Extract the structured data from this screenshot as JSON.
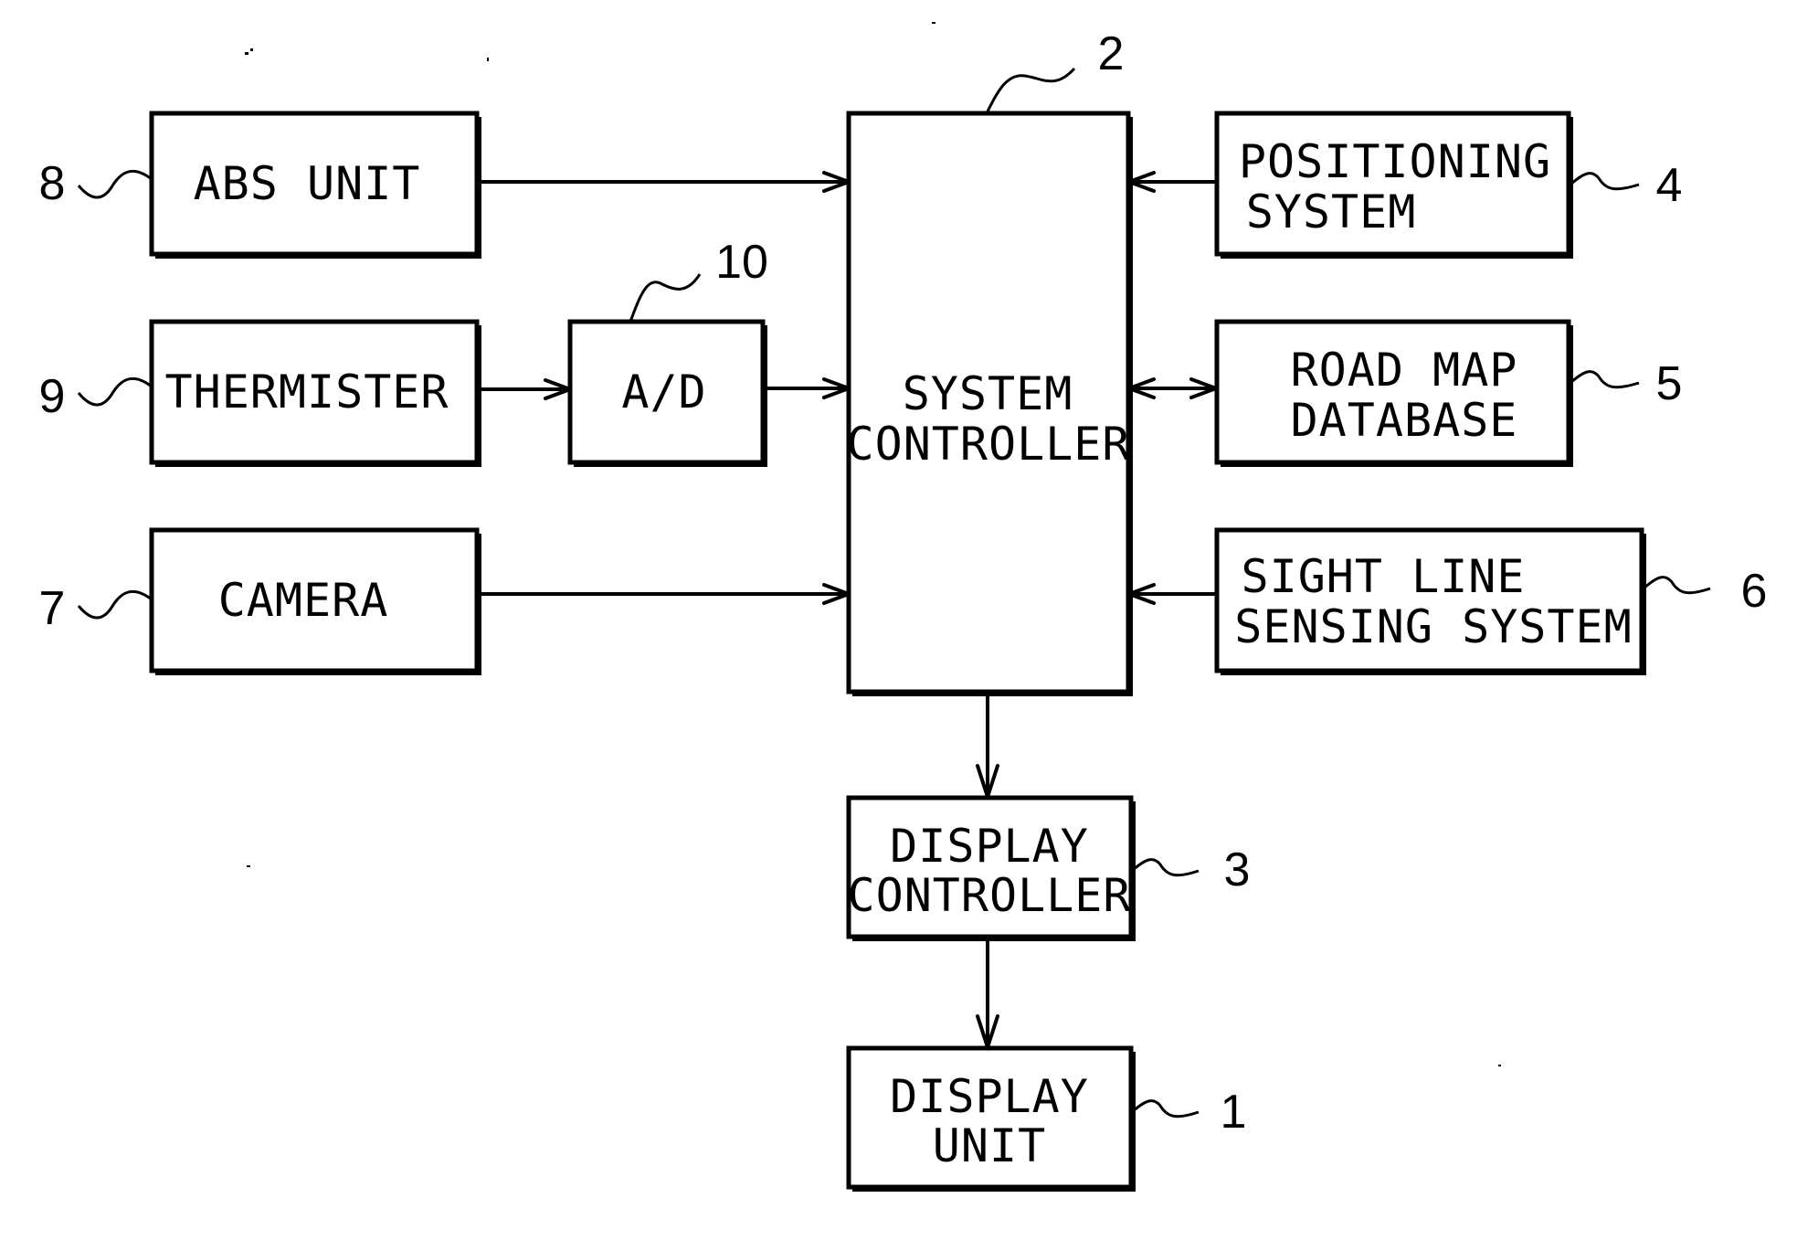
{
  "figure": {
    "type": "block-diagram",
    "colors": {
      "ink": "#000000",
      "paper": "#ffffff"
    }
  },
  "blocks": {
    "abs_unit": {
      "ref": "8",
      "lines": [
        "ABS UNIT"
      ]
    },
    "thermister": {
      "ref": "9",
      "lines": [
        "THERMISTER"
      ]
    },
    "ad_converter": {
      "ref": "10",
      "lines": [
        "A/D"
      ]
    },
    "camera": {
      "ref": "7",
      "lines": [
        "CAMERA"
      ]
    },
    "system_controller": {
      "ref": "2",
      "lines": [
        "SYSTEM",
        "CONTROLLER"
      ]
    },
    "positioning_system": {
      "ref": "4",
      "lines": [
        "POSITIONING",
        "SYSTEM"
      ]
    },
    "road_map_database": {
      "ref": "5",
      "lines": [
        "ROAD MAP",
        "DATABASE"
      ]
    },
    "sight_line_sensing_system": {
      "ref": "6",
      "lines": [
        "SIGHT LINE",
        "SENSING SYSTEM"
      ]
    },
    "display_controller": {
      "ref": "3",
      "lines": [
        "DISPLAY",
        "CONTROLLER"
      ]
    },
    "display_unit": {
      "ref": "1",
      "lines": [
        "DISPLAY",
        "UNIT"
      ]
    }
  },
  "connections": [
    {
      "from": "abs_unit",
      "to": "system_controller",
      "direction": "forward"
    },
    {
      "from": "thermister",
      "to": "ad_converter",
      "direction": "forward"
    },
    {
      "from": "ad_converter",
      "to": "system_controller",
      "direction": "forward"
    },
    {
      "from": "camera",
      "to": "system_controller",
      "direction": "forward"
    },
    {
      "from": "positioning_system",
      "to": "system_controller",
      "direction": "forward"
    },
    {
      "from": "road_map_database",
      "to": "system_controller",
      "direction": "bidirectional"
    },
    {
      "from": "sight_line_sensing_system",
      "to": "system_controller",
      "direction": "forward"
    },
    {
      "from": "system_controller",
      "to": "display_controller",
      "direction": "forward"
    },
    {
      "from": "display_controller",
      "to": "display_unit",
      "direction": "forward"
    }
  ]
}
